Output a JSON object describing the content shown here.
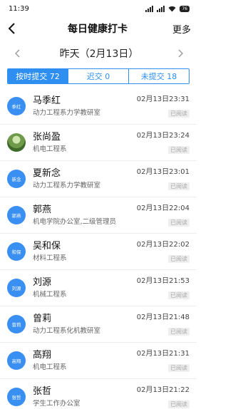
{
  "status": {
    "time": "11:39",
    "battery": "76"
  },
  "nav": {
    "title": "每日健康打卡",
    "more": "更多"
  },
  "date": {
    "label": "昨天（2月13日）"
  },
  "tabs": [
    {
      "label": "按时提交 72",
      "active": true
    },
    {
      "label": "迟交 0",
      "active": false
    },
    {
      "label": "未提交 18",
      "active": false
    }
  ],
  "records": [
    {
      "avatar": "季红",
      "name": "马季红",
      "dept": "动力工程系力学教研室",
      "time": "02月13日23:31",
      "status": "已阅读"
    },
    {
      "avatar": "",
      "name": "张尚盈",
      "dept": "机电工程系",
      "time": "02月13日23:24",
      "status": "已阅读"
    },
    {
      "avatar": "新念",
      "name": "夏新念",
      "dept": "动力工程系力学教研室",
      "time": "02月13日23:01",
      "status": "已阅读"
    },
    {
      "avatar": "郭燕",
      "name": "郭燕",
      "dept": "机电学院办公室,二级管理员",
      "time": "02月13日22:04",
      "status": "已阅读"
    },
    {
      "avatar": "和保",
      "name": "吴和保",
      "dept": "材料工程系",
      "time": "02月13日22:02",
      "status": "已阅读"
    },
    {
      "avatar": "刘源",
      "name": "刘源",
      "dept": "机械工程系",
      "time": "02月13日21:53",
      "status": "已阅读"
    },
    {
      "avatar": "曾莉",
      "name": "曾莉",
      "dept": "动力工程系化机教研室",
      "time": "02月13日21:48",
      "status": "已阅读"
    },
    {
      "avatar": "高翔",
      "name": "高翔",
      "dept": "机电工程系",
      "time": "02月13日21:31",
      "status": "已阅读"
    },
    {
      "avatar": "张哲",
      "name": "张哲",
      "dept": "学生工作办公室",
      "time": "02月13日21:22",
      "status": "已阅读"
    }
  ],
  "colors": {
    "accent": "#2f8ff0",
    "avatar": "#3a8ff2"
  }
}
